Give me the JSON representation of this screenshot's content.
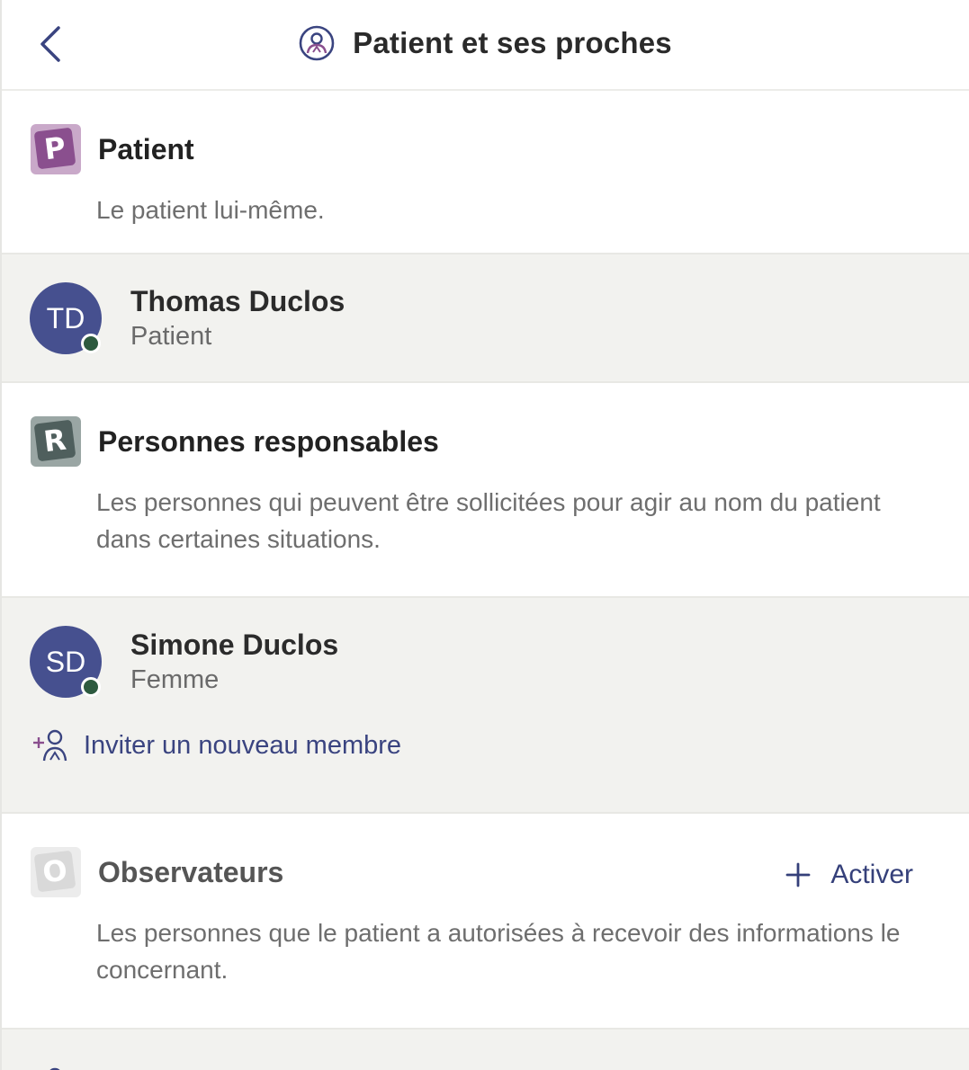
{
  "header": {
    "title": "Patient et ses proches",
    "back_icon": "chevron-left-icon",
    "title_icon": "person-circle-icon"
  },
  "sections": {
    "patient": {
      "badge_letter": "P",
      "badge_color": "#8a4f8e",
      "badge_back_color": "#c9a9c9",
      "title": "Patient",
      "description": "Le patient lui-même."
    },
    "responsables": {
      "badge_letter": "R",
      "badge_color": "#4f5f5d",
      "badge_back_color": "#9aa6a4",
      "title": "Personnes responsables",
      "description": "Les personnes qui peuvent être sollicitées pour agir au nom du patient dans certaines situations."
    },
    "observateurs": {
      "badge_letter": "O",
      "badge_color": "#d9d9d9",
      "badge_back_color": "#ececec",
      "title": "Observateurs",
      "activate_label": "Activer",
      "description": "Les personnes que le patient a autorisées à recevoir des informations le concernant."
    }
  },
  "members": {
    "patient": {
      "initials": "TD",
      "name": "Thomas Duclos",
      "role": "Patient",
      "status": "online"
    },
    "responsable": {
      "initials": "SD",
      "name": "Simone Duclos",
      "role": "Femme",
      "status": "online"
    }
  },
  "invite": {
    "label": "Inviter un nouveau membre",
    "icon": "add-person-icon"
  },
  "colors": {
    "accent": "#35407a",
    "avatar": "#46508f",
    "presence": "#2d5a3f",
    "panel_bg": "#f2f2ef"
  }
}
